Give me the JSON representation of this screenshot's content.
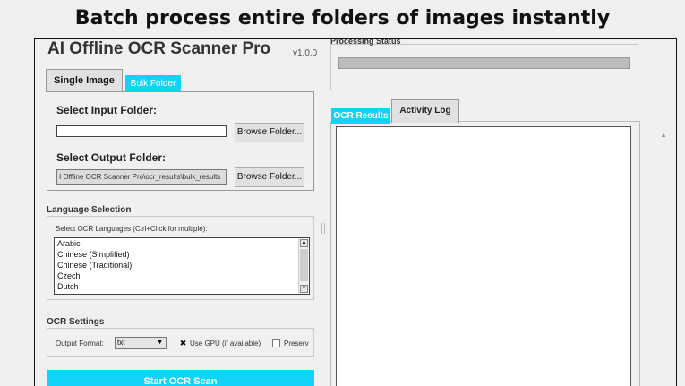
{
  "banner": {
    "headline": "Batch process entire folders of images instantly"
  },
  "app": {
    "title": "AI Offline OCR Scanner Pro",
    "version": "v1.0.0"
  },
  "mode_tabs": {
    "single": "Single Image",
    "bulk": "Bulk Folder"
  },
  "bulk": {
    "input_label": "Select Input Folder:",
    "input_value": "",
    "browse_input": "Browse Folder...",
    "output_label": "Select Output Folder:",
    "output_value": "I Offline OCR Scanner Pro\\ocr_results\\bulk_results",
    "browse_output": "Browse Folder..."
  },
  "language": {
    "section": "Language Selection",
    "hint": "Select OCR Languages (Ctrl+Click for multiple):",
    "options": [
      "Arabic",
      "Chinese (Simplified)",
      "Chinese (Traditional)",
      "Czech",
      "Dutch"
    ]
  },
  "settings": {
    "section": "OCR Settings",
    "format_label": "Output Format:",
    "format_value": "txt",
    "use_gpu": "Use GPU (if available)",
    "use_gpu_checked": true,
    "preserve": "Preserv",
    "preserve_checked": false
  },
  "start_button": "Start OCR Scan",
  "processing": {
    "label": "Processing Status",
    "progress": 0
  },
  "result_tabs": {
    "ocr": "OCR Results",
    "log": "Activity Log"
  },
  "results_text": "",
  "colors": {
    "accent": "#12d3f5"
  }
}
